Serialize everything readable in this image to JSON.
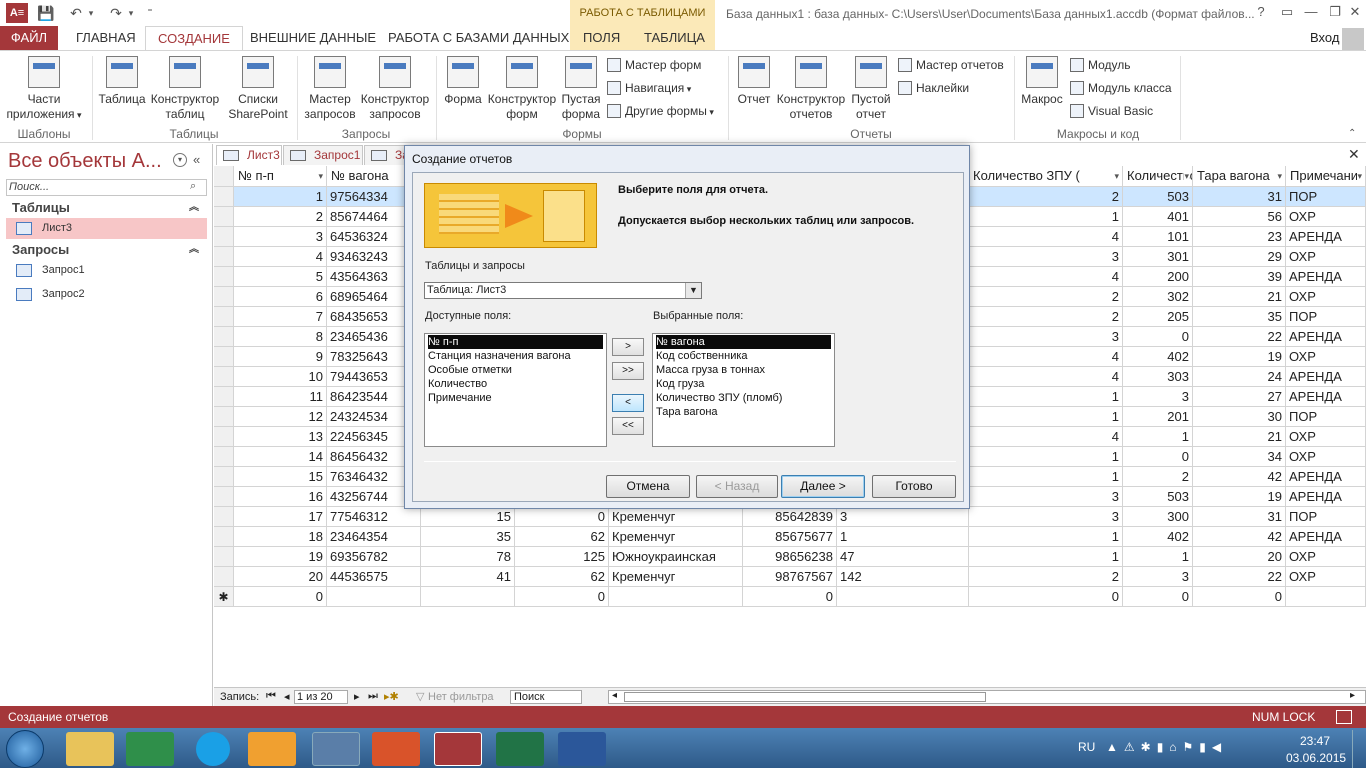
{
  "titlebar": {
    "contextual_header": "РАБОТА С ТАБЛИЦАМИ",
    "window_title": "База данных1 : база данных- C:\\Users\\User\\Documents\\База данных1.accdb (Формат файлов..."
  },
  "ribbon_tabs": [
    "ФАЙЛ",
    "ГЛАВНАЯ",
    "СОЗДАНИЕ",
    "ВНЕШНИЕ ДАННЫЕ",
    "РАБОТА С БАЗАМИ ДАННЫХ",
    "ПОЛЯ",
    "ТАБЛИЦА"
  ],
  "signin": "Вход",
  "ribbon": {
    "big": [
      {
        "label": "Части\nприложения",
        "arrow": true
      },
      {
        "label": "Таблица"
      },
      {
        "label": "Конструктор\nтаблиц"
      },
      {
        "label": "Списки\nSharePoint",
        "arrow": true
      },
      {
        "label": "Мастер\nзапросов"
      },
      {
        "label": "Конструктор\nзапросов"
      },
      {
        "label": "Форма"
      },
      {
        "label": "Конструктор\nформ"
      },
      {
        "label": "Пустая\nформа"
      },
      {
        "label": "Отчет"
      },
      {
        "label": "Конструктор\nотчетов"
      },
      {
        "label": "Пустой\nотчет"
      },
      {
        "label": "Макрос"
      }
    ],
    "small": [
      "Мастер форм",
      "Навигация",
      "Другие формы",
      "Мастер отчетов",
      "Наклейки",
      "Модуль",
      "Модуль класса",
      "Visual Basic"
    ],
    "groups": [
      "Шаблоны",
      "Таблицы",
      "Запросы",
      "Формы",
      "Отчеты",
      "Макросы и код"
    ]
  },
  "nav": {
    "title": "Все объекты A...",
    "search_placeholder": "Поиск...",
    "sections": [
      {
        "header": "Таблицы",
        "items": [
          "Лист3"
        ]
      },
      {
        "header": "Запросы",
        "items": [
          "Запрос1",
          "Запрос2"
        ]
      }
    ]
  },
  "doc_tabs": [
    "Лист3",
    "Запрос1",
    "За"
  ],
  "grid": {
    "headers": [
      "№ п-п",
      "№ вагона",
      "",
      "",
      "",
      "",
      "",
      "Количество ЗПУ (",
      "Количество",
      "Тара вагона",
      "Примечани"
    ],
    "rows": [
      [
        "1",
        "97564334",
        "",
        "",
        "",
        "",
        "",
        "2",
        "503",
        "31",
        "ПОР"
      ],
      [
        "2",
        "85674464",
        "",
        "",
        "",
        "",
        "",
        "1",
        "401",
        "56",
        "ОХР"
      ],
      [
        "3",
        "64536324",
        "",
        "",
        "",
        "",
        "",
        "4",
        "101",
        "23",
        "АРЕНДА"
      ],
      [
        "4",
        "93463243",
        "",
        "",
        "",
        "",
        "",
        "3",
        "301",
        "29",
        "ОХР"
      ],
      [
        "5",
        "43564363",
        "",
        "",
        "",
        "",
        "",
        "4",
        "200",
        "39",
        "АРЕНДА"
      ],
      [
        "6",
        "68965464",
        "",
        "",
        "",
        "",
        "",
        "2",
        "302",
        "21",
        "ОХР"
      ],
      [
        "7",
        "68435653",
        "",
        "",
        "",
        "",
        "",
        "2",
        "205",
        "35",
        "ПОР"
      ],
      [
        "8",
        "23465436",
        "",
        "",
        "",
        "",
        "",
        "3",
        "0",
        "22",
        "АРЕНДА"
      ],
      [
        "9",
        "78325643",
        "",
        "",
        "",
        "",
        "",
        "4",
        "402",
        "19",
        "ОХР"
      ],
      [
        "10",
        "79443653",
        "",
        "",
        "",
        "",
        "",
        "4",
        "303",
        "24",
        "АРЕНДА"
      ],
      [
        "11",
        "86423544",
        "",
        "",
        "",
        "",
        "",
        "1",
        "3",
        "27",
        "АРЕНДА"
      ],
      [
        "12",
        "24324534",
        "",
        "",
        "",
        "",
        "",
        "1",
        "201",
        "30",
        "ПОР"
      ],
      [
        "13",
        "22456345",
        "",
        "",
        "",
        "",
        "",
        "4",
        "1",
        "21",
        "ОХР"
      ],
      [
        "14",
        "86456432",
        "",
        "",
        "",
        "",
        "",
        "1",
        "0",
        "34",
        "ОХР"
      ],
      [
        "15",
        "76346432",
        "",
        "",
        "",
        "",
        "",
        "1",
        "2",
        "42",
        "АРЕНДА"
      ],
      [
        "16",
        "43256744",
        "",
        "",
        "",
        "",
        "",
        "3",
        "503",
        "19",
        "АРЕНДА"
      ],
      [
        "17",
        "77546312",
        "15",
        "0",
        "Кременчуг",
        "85642839",
        "3",
        "3",
        "300",
        "31",
        "ПОР"
      ],
      [
        "18",
        "23464354",
        "35",
        "62",
        "Кременчуг",
        "85675677",
        "1",
        "1",
        "402",
        "42",
        "АРЕНДА"
      ],
      [
        "19",
        "69356782",
        "78",
        "125",
        "Южноукраинская",
        "98656238",
        "47",
        "1",
        "1",
        "20",
        "ОХР"
      ],
      [
        "20",
        "44536575",
        "41",
        "62",
        "Кременчуг",
        "98767567",
        "142",
        "2",
        "3",
        "22",
        "ОХР"
      ],
      [
        "0",
        "",
        "",
        "0",
        "",
        "0",
        "",
        "0",
        "0",
        "0",
        ""
      ]
    ],
    "new_row_marker": "✱"
  },
  "record_bar": {
    "label": "Запись:",
    "position": "1 из 20",
    "filter": "Нет фильтра",
    "search": "Поиск"
  },
  "status": {
    "left": "Создание отчетов",
    "right": "NUM LOCK"
  },
  "dialog": {
    "title": "Создание отчетов",
    "heading1": "Выберите поля для отчета.",
    "heading2": "Допускается выбор нескольких таблиц или запросов.",
    "tables_label": "Таблицы и запросы",
    "table_value": "Таблица: Лист3",
    "available_label": "Доступные поля:",
    "selected_label": "Выбранные поля:",
    "available": [
      "№ п-п",
      "Станция назначения вагона",
      "Особые отметки",
      "Количество",
      "Примечание"
    ],
    "selected": [
      "№ вагона",
      "Код собственника",
      "Масса груза в тоннах",
      "Код груза",
      "Количество ЗПУ (пломб)",
      "Тара вагона"
    ],
    "arrows": [
      ">",
      ">>",
      "<",
      "<<"
    ],
    "buttons": {
      "cancel": "Отмена",
      "back": "< Назад",
      "next": "Далее >",
      "finish": "Готово"
    }
  },
  "taskbar": {
    "lang": "RU",
    "time": "23:47",
    "date": "03.06.2015"
  },
  "colors": {
    "accent": "#a4373a",
    "selection": "#cde6ff",
    "taskbar": "#3c6ea0"
  }
}
